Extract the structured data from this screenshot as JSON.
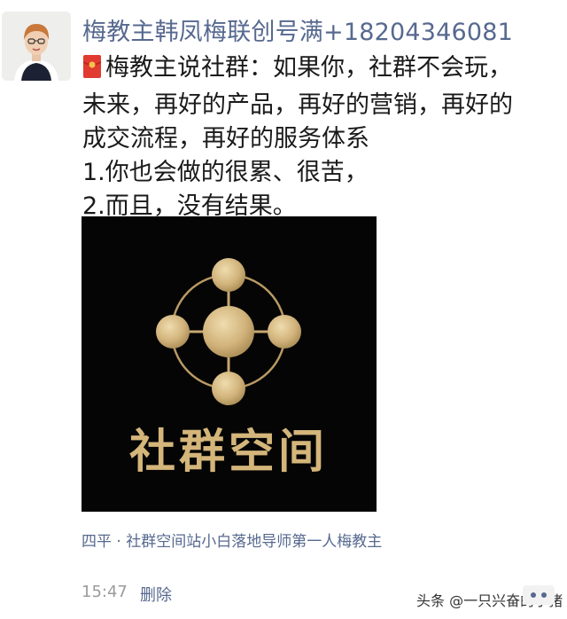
{
  "post": {
    "author": "梅教主韩凤梅联创号满+18204346081",
    "lines": [
      "梅教主说社群：如果你，社群不会玩，",
      "未来，再好的产品，再好的营销，再好的",
      "成交流程，再好的服务体系",
      "1.你也会做的很累、很苦，",
      "2.而且，没有结果。"
    ],
    "image_caption": "社群空间",
    "location": "四平 · 社群空间站小白落地导师第一人梅教主",
    "time": "15:47",
    "delete_label": "删除"
  },
  "watermark": "头条 @一只兴奋的小猪",
  "colors": {
    "link_blue": "#57698f",
    "gold": "#c9a96a",
    "image_bg": "#050505",
    "time_gray": "#9b9b9b"
  },
  "icons": {
    "red_packet": "red-packet-icon",
    "more": "more-options-icon"
  }
}
